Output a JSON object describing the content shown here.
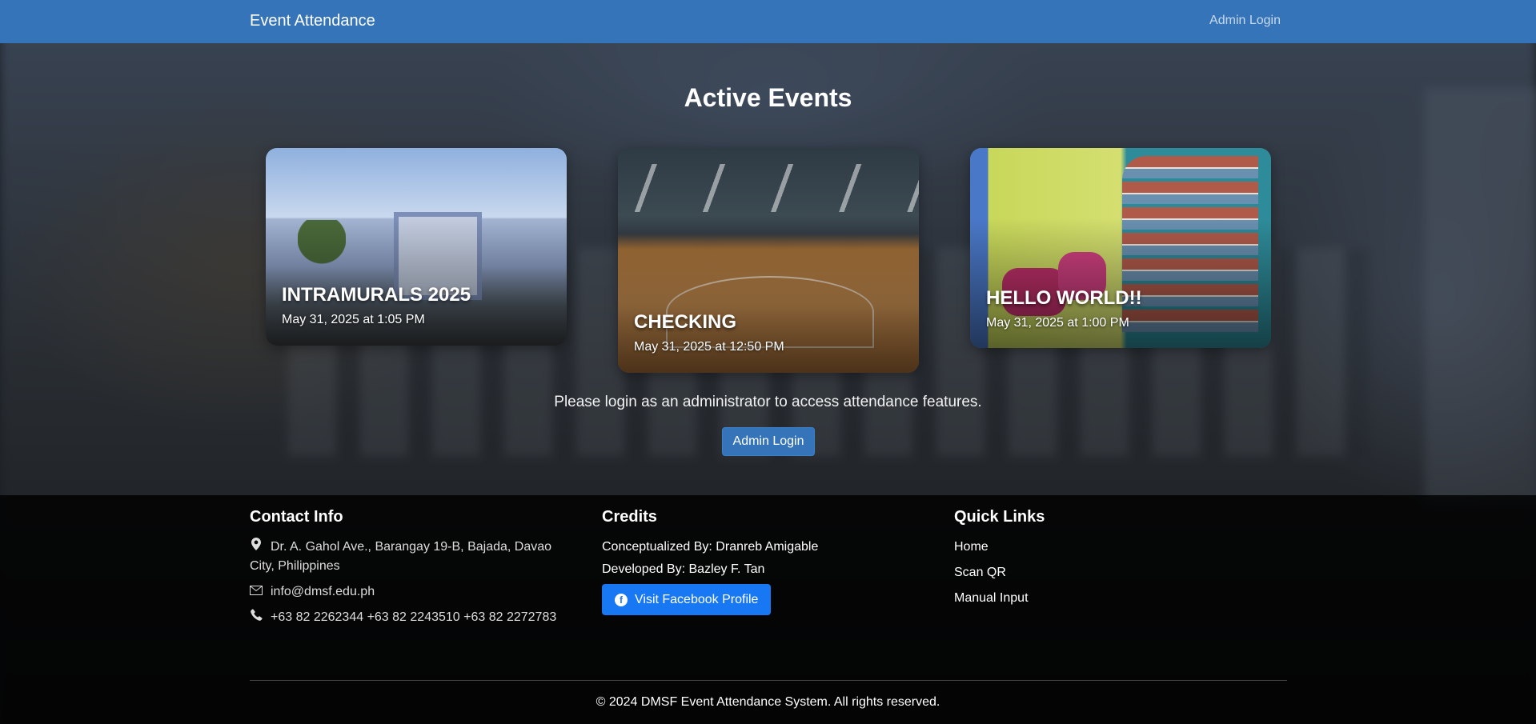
{
  "navbar": {
    "brand": "Event Attendance",
    "admin_link": "Admin Login"
  },
  "main": {
    "title": "Active Events",
    "events": [
      {
        "title": "INTRAMURALS 2025",
        "date": "May 31, 2025 at 1:05 PM"
      },
      {
        "title": "CHECKING",
        "date": "May 31, 2025 at 12:50 PM"
      },
      {
        "title": "HELLO WORLD!!",
        "date": "May 31, 2025 at 1:00 PM"
      }
    ],
    "login_message": "Please login as an administrator to access attendance features.",
    "login_button": "Admin Login"
  },
  "footer": {
    "contact": {
      "heading": "Contact Info",
      "address": "Dr. A. Gahol Ave., Barangay 19-B, Bajada, Davao City, Philippines",
      "email": "info@dmsf.edu.ph",
      "phone": "+63 82 2262344 +63 82 2243510 +63 82 2272783"
    },
    "credits": {
      "heading": "Credits",
      "conceptualized": "Conceptualized By: Dranreb Amigable",
      "developed": "Developed By: Bazley F. Tan",
      "facebook_button": "Visit Facebook Profile"
    },
    "links": {
      "heading": "Quick Links",
      "items": [
        "Home",
        "Scan QR",
        "Manual Input"
      ]
    },
    "copyright": "© 2024 DMSF Event Attendance System. All rights reserved."
  },
  "colors": {
    "navbar": "#3574b8",
    "facebook": "#1877f2",
    "footer": "#000000"
  }
}
